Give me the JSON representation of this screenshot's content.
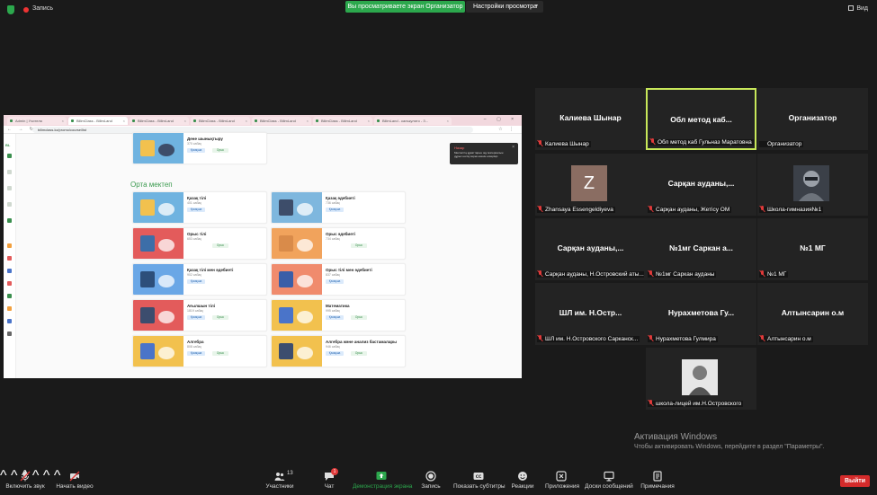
{
  "topbar": {
    "record_label": "Запись",
    "share_banner": "Вы просматриваете экран Организатор",
    "view_settings": "Настройки просмотра",
    "view_label": "Вид"
  },
  "browser": {
    "tabs": [
      {
        "label": "Admin | Учителя"
      },
      {
        "label": "BilimClass - BilimLand"
      },
      {
        "label": "BilimClass - BilimLand"
      },
      {
        "label": "BilimClass - BilimLand"
      },
      {
        "label": "BilimClass - BilimLand"
      },
      {
        "label": "BilimClass - BilimLand"
      },
      {
        "label": "BilimLand - калькулято - З..."
      }
    ],
    "url": "bilimclass.kz/promo/course/list",
    "top_card": {
      "title": "Дене шынықтыру",
      "sub": "370 сабақ",
      "tag1": "Қазақша",
      "tag2": "Орыс"
    },
    "section_title": "Орта мектеп",
    "cards": [
      {
        "title": "Қазақ тілі",
        "sub": "401 сабақ",
        "tag1": "Қазақша",
        "tag2": "",
        "c1": "#6fb3e0",
        "c2": "#f2c14e"
      },
      {
        "title": "Қазақ әдебиеті",
        "sub": "736 сабақ",
        "tag1": "Қазақша",
        "tag2": "",
        "c1": "#7eb7de",
        "c2": "#3d4d6a"
      },
      {
        "title": "Орыс тілі",
        "sub": "653 сабақ",
        "tag1": "",
        "tag2": "Орыс",
        "c1": "#e35b5b",
        "c2": "#3c6ea8"
      },
      {
        "title": "Орыс әдебиеті",
        "sub": "734 сабақ",
        "tag1": "",
        "tag2": "Орыс",
        "c1": "#f1a35c",
        "c2": "#d98b4a"
      },
      {
        "title": "Қазақ тілі мен әдебиеті",
        "sub": "902 сабақ",
        "tag1": "Қазақша",
        "tag2": "",
        "c1": "#6aa7e6",
        "c2": "#2d4f7a"
      },
      {
        "title": "Орыс тілі мен әдебиеті",
        "sub": "837 сабақ",
        "tag1": "Қазақша",
        "tag2": "",
        "c1": "#f08b6d",
        "c2": "#3a5ea8"
      },
      {
        "title": "Ағылшын тілі",
        "sub": "1819 сабақ",
        "tag1": "Қазақша",
        "tag2": "Орыс",
        "c1": "#e35b5b",
        "c2": "#3c4d6e"
      },
      {
        "title": "Математика",
        "sub": "995 сабақ",
        "tag1": "Қазақша",
        "tag2": "Орыс",
        "c1": "#f2c14e",
        "c2": "#4a74c9"
      },
      {
        "title": "Алгебра",
        "sub": "808 сабақ",
        "tag1": "Қазақша",
        "tag2": "Орыс",
        "c1": "#f2c14e",
        "c2": "#4a74c9"
      },
      {
        "title": "Алгебра және анализ бастамалары",
        "sub": "946 сабақ",
        "tag1": "Қазақша",
        "tag2": "Орыс",
        "c1": "#f2c14e",
        "c2": "#3c4d6e"
      }
    ],
    "notification": {
      "title": "Назар",
      "body": "Мектептің құжаттарын оқу материалын дұрыс енгізу керек екенін ескеріңіз"
    }
  },
  "participants": [
    {
      "name": "Калиева Шынар",
      "label": "Калиева Шынар",
      "type": "name"
    },
    {
      "name": "Обл метод каб...",
      "label": "Обл метод каб Гульназ Маратовна",
      "type": "name",
      "active": true
    },
    {
      "name": "Организатор",
      "label": "Организатор",
      "type": "name",
      "mic_on": true
    },
    {
      "name": "Z",
      "label": "Zhansaya Essengeldiyeva",
      "type": "avatar"
    },
    {
      "name": "Сарқан ауданы,...",
      "label": "Сарқан ауданы, Жетісу ОМ",
      "type": "name"
    },
    {
      "name": "",
      "label": "Школа-гимназия№1",
      "type": "photo"
    },
    {
      "name": "Сарқан ауданы,...",
      "label": "Сарқан ауданы, Н.Островский аты...",
      "type": "name"
    },
    {
      "name": "№1мг Саркан а...",
      "label": "№1мг Саркан ауданы",
      "type": "name"
    },
    {
      "name": "№1 МГ",
      "label": "№1 МГ",
      "type": "name"
    },
    {
      "name": "ШЛ им. Н.Остр...",
      "label": "ШЛ им. Н.Островского Сарканск...",
      "type": "name"
    },
    {
      "name": "Нурахметова Гу...",
      "label": "Нурахметова Гулмира",
      "type": "name"
    },
    {
      "name": "Алтынсарин о.м",
      "label": "Алтынсарин о.м",
      "type": "name"
    },
    {
      "name": "",
      "label": "школа-лицей им.Н.Островского",
      "type": "photo2"
    }
  ],
  "activation": {
    "title": "Активация Windows",
    "sub": "Чтобы активировать Windows, перейдите в раздел \"Параметры\"."
  },
  "toolbar": {
    "audio": "Включить звук",
    "video": "Начать видео",
    "participants": "Участники",
    "participants_count": "13",
    "chat": "Чат",
    "chat_badge": "1",
    "share": "Демонстрация экрана",
    "record": "Запись",
    "captions": "Показать субтитры",
    "reactions": "Реакции",
    "apps": "Приложения",
    "whiteboards": "Доски сообщений",
    "notes": "Примечания",
    "leave": "Выйти"
  },
  "colors": {
    "accent_green": "#2ca84d",
    "active_border": "#c8e85a",
    "leave_red": "#d42b2b"
  }
}
